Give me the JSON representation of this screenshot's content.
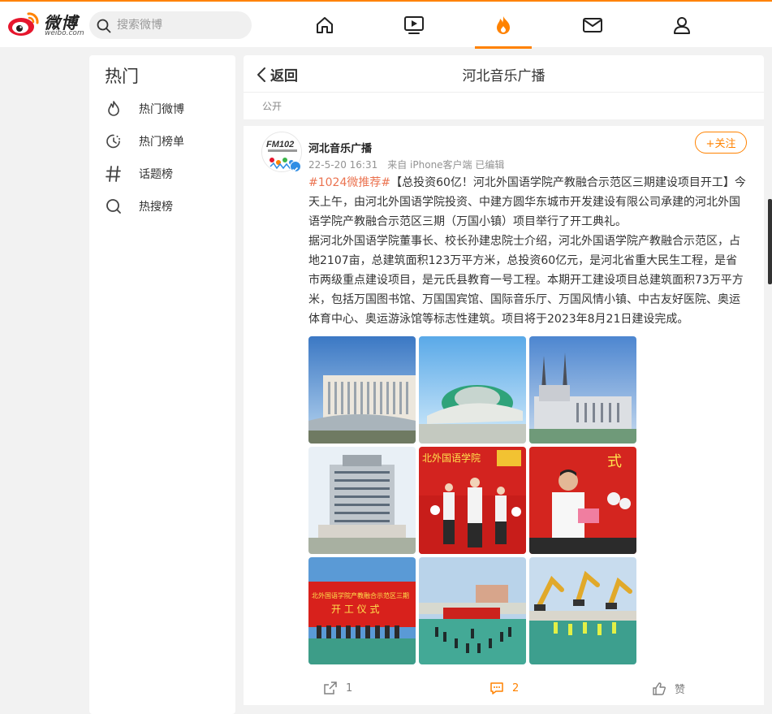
{
  "topbar": {
    "logo_text": "微博",
    "logo_sub": "weibo.com",
    "search_placeholder": "搜索微博",
    "nav": [
      {
        "name": "home-icon"
      },
      {
        "name": "video-icon"
      },
      {
        "name": "hot-fire-icon",
        "active": true
      },
      {
        "name": "mail-icon"
      },
      {
        "name": "profile-icon"
      }
    ],
    "accent": "#ff8200"
  },
  "sidebar": {
    "title": "热门",
    "items": [
      {
        "label": "热门微博",
        "icon": "flame-icon"
      },
      {
        "label": "热门榜单",
        "icon": "clock-icon"
      },
      {
        "label": "话题榜",
        "icon": "hashtag-icon"
      },
      {
        "label": "热搜榜",
        "icon": "search-icon"
      }
    ]
  },
  "main": {
    "back_label": "返回",
    "title": "河北音乐广播",
    "visibility": "公开",
    "post": {
      "author": "河北音乐广播",
      "meta": "22-5-20 16:31　来自 iPhone客户端 已编辑",
      "follow_label": "+关注",
      "tag": "#1024微推荐#",
      "text_1": "【总投资60亿！河北外国语学院产教融合示范区三期建设项目开工】今天上午，由河北外国语学院投资、中建方圆华东城市开发建设有限公司承建的河北外国语学院产教融合示范区三期（万国小镇）项目举行了开工典礼。",
      "text_2": "据河北外国语学院董事长、校长孙建忠院士介绍，河北外国语学院产教融合示范区，占地2107亩，总建筑面积123万平方米，总投资60亿元，是河北省重大民生工程，是省市两级重点建设项目，是元氏县教育一号工程。本期开工建设项目总建筑面积73万平方米，包括万国图书馆、万国国宾馆、国际音乐厅、万国风情小镇、中古友好医院、奥运体育中心、奥运游泳馆等标志性建筑。项目将于2023年8月21日建设完成。",
      "photos": [
        {
          "name": "photo-library-building"
        },
        {
          "name": "photo-stadium-dome"
        },
        {
          "name": "photo-cathedral-building"
        },
        {
          "name": "photo-hotel-tower"
        },
        {
          "name": "photo-ceremony-speakers"
        },
        {
          "name": "photo-speaker-podium"
        },
        {
          "name": "photo-stage-banner"
        },
        {
          "name": "photo-ceremony-field"
        },
        {
          "name": "photo-excavators"
        }
      ],
      "actions": {
        "repost_count": "1",
        "comment_count": "2",
        "like_label": "赞"
      }
    }
  }
}
